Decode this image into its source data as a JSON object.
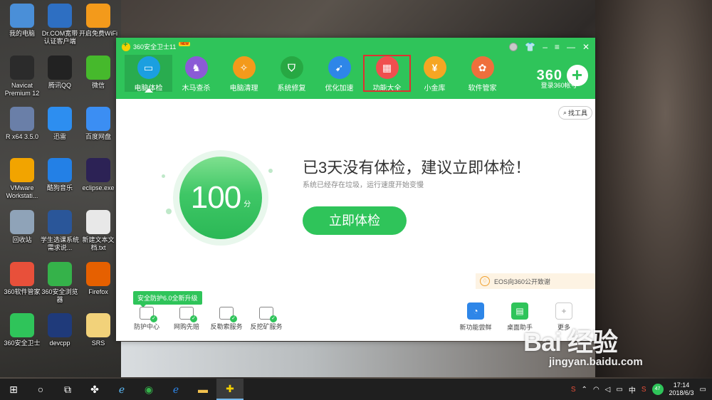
{
  "desktop": {
    "icons": [
      {
        "label": "我的电脑",
        "icon": "computer-icon",
        "color": "#4a8fd8"
      },
      {
        "label": "Dr.COM宽带认证客户端",
        "icon": "drcom-icon",
        "color": "#2e6fc2"
      },
      {
        "label": "开启免费WiFi",
        "icon": "wifi-icon",
        "color": "#f39a1b"
      },
      {
        "label": "Navicat Premium 12",
        "icon": "navicat-icon",
        "color": "#2b2b2b"
      },
      {
        "label": "腾讯QQ",
        "icon": "qq-icon",
        "color": "#222"
      },
      {
        "label": "微信",
        "icon": "wechat-icon",
        "color": "#46b92c"
      },
      {
        "label": "R x64 3.5.0",
        "icon": "r-icon",
        "color": "#6a7fa8"
      },
      {
        "label": "迅雷",
        "icon": "thunder-icon",
        "color": "#2d8ef0"
      },
      {
        "label": "百度网盘",
        "icon": "baidu-netdisk-icon",
        "color": "#3b8ef3"
      },
      {
        "label": "VMware Workstati...",
        "icon": "vmware-icon",
        "color": "#f2a400"
      },
      {
        "label": "酷狗音乐",
        "icon": "kugou-icon",
        "color": "#2380e6"
      },
      {
        "label": "eclipse.exe",
        "icon": "eclipse-icon",
        "color": "#2c2255"
      },
      {
        "label": "回收站",
        "icon": "recycle-bin-icon",
        "color": "#8fa3b8"
      },
      {
        "label": "学生选课系统需求说...",
        "icon": "word-doc-icon",
        "color": "#2a5699"
      },
      {
        "label": "新建文本文档.txt",
        "icon": "text-file-icon",
        "color": "#e8e8e8"
      },
      {
        "label": "360软件管家",
        "icon": "360-software-icon",
        "color": "#e8503a"
      },
      {
        "label": "360安全浏览器",
        "icon": "360-browser-icon",
        "color": "#35b24a"
      },
      {
        "label": "Firefox",
        "icon": "firefox-icon",
        "color": "#e66000"
      },
      {
        "label": "360安全卫士",
        "icon": "360-guard-icon",
        "color": "#2fc45a"
      },
      {
        "label": "devcpp",
        "icon": "devcpp-icon",
        "color": "#1f3a7a"
      },
      {
        "label": "SRS",
        "icon": "folder-icon",
        "color": "#f2d27a"
      }
    ]
  },
  "window": {
    "title": "360安全卫士11",
    "new_badge": "NEW",
    "nav": [
      {
        "label": "电脑体检",
        "icon": "pc-checkup-icon",
        "color": "#1b9fe0",
        "glyph": "▭"
      },
      {
        "label": "木马查杀",
        "icon": "trojan-scan-icon",
        "color": "#8b5bd6",
        "glyph": "♞"
      },
      {
        "label": "电脑清理",
        "icon": "pc-clean-icon",
        "color": "#f39a1b",
        "glyph": "✧"
      },
      {
        "label": "系统修复",
        "icon": "system-repair-icon",
        "color": "#27a843",
        "glyph": "⛉"
      },
      {
        "label": "优化加速",
        "icon": "speedup-icon",
        "color": "#2e86e8",
        "glyph": "➹"
      },
      {
        "label": "功能大全",
        "icon": "all-features-icon",
        "color": "#f04f4f",
        "glyph": "▦"
      },
      {
        "label": "小金库",
        "icon": "treasury-icon",
        "color": "#f5a623",
        "glyph": "¥"
      },
      {
        "label": "软件管家",
        "icon": "software-manager-icon",
        "color": "#ef6f3c",
        "glyph": "✿"
      }
    ],
    "account_logo": "360",
    "account_label": "登录360帐号",
    "search_tool": "找工具",
    "score_value": "100",
    "score_unit": "分",
    "headline": "已3天没有体检，建议立即体检！",
    "subline": "系统已经存在垃圾，运行速度开始变慢",
    "cta": "立即体检",
    "eos_notice": "EOS向360公开致谢",
    "upgrade_tip": "安全防护6.0全新升级",
    "bottom_tools": [
      "防护中心",
      "网购先赔",
      "反勒索服务",
      "反挖矿服务"
    ],
    "right_tools": [
      {
        "label": "新功能尝鲜",
        "icon": "new-feature-icon",
        "color": "#2e86e8",
        "glyph": "◔"
      },
      {
        "label": "桌面助手",
        "icon": "desktop-helper-icon",
        "color": "#2fc45a",
        "glyph": "▤"
      },
      {
        "label": "更多",
        "icon": "more-plus-icon",
        "color": "#ffffff",
        "glyph": "+"
      }
    ]
  },
  "taskbar": {
    "time": "17:14",
    "date": "2018/6/3",
    "ime": "中",
    "badge": "47"
  },
  "watermark": {
    "logo": "Bai 经验",
    "url": "jingyan.baidu.com"
  }
}
